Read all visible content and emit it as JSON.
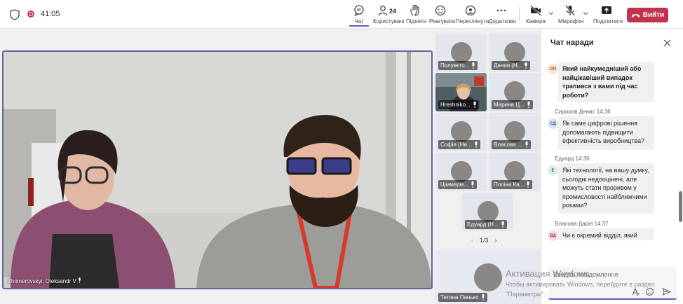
{
  "topbar": {
    "timer": "41:05",
    "participants_count": "24",
    "buttons": {
      "chat": "Чат",
      "people": "Користувачі",
      "raise": "Підняти",
      "react": "Реагувати",
      "view": "Переглянути",
      "more": "Додатково",
      "camera": "Камера",
      "mic": "Мікрофон",
      "share": "Поділитися"
    },
    "leave": "Вийти"
  },
  "main_video": {
    "name": "Zholnerovskyi, Oleksandr V"
  },
  "gallery": {
    "tiles": [
      {
        "name": "Полуекто..."
      },
      {
        "name": "Дания (Н..."
      },
      {
        "name": "Hreshniko..."
      },
      {
        "name": "Марина Ц..."
      },
      {
        "name": "Софія (Не..."
      },
      {
        "name": "Власова ..."
      },
      {
        "name": "Ціммерм..."
      },
      {
        "name": "Поліна Ка..."
      },
      {
        "name": "Едуард (Н..."
      },
      {
        "name": "Тетяна Панько"
      }
    ],
    "page": "1/3"
  },
  "chat": {
    "title": "Чат наради",
    "messages": [
      {
        "sender": "",
        "initials": "OO",
        "text": "Який найкумедніший або найцікавіший випадок трапився з вами під час роботи?",
        "color": "#f8e3d6",
        "fg": "#a0522d"
      },
      {
        "sender": "Сидоров Денис  14:36",
        "initials": "СД",
        "text": "Як саме цифрові рішення допомагають підвищити ефективність виробництва?",
        "color": "#dde3f5",
        "fg": "#3b4b8a"
      },
      {
        "sender": "Едуард  14:36",
        "initials": "Е",
        "text": "Які технології, на вашу думку, сьогодні недооцінені, але можуть стати проривом у промисловості найближчими роками?",
        "color": "#dcefe0",
        "fg": "#2e6b3c"
      },
      {
        "sender": "Власова Дарія  14:37",
        "initials": "ВД",
        "text": "Чи є окремий відділ, який",
        "color": "#f7dedf",
        "fg": "#a0303b"
      }
    ],
    "compose_placeholder": "Введіть повідомлення"
  },
  "watermark": {
    "title": "Активация Windows",
    "line1": "Чтобы активировать Windows, перейдите в раздел",
    "line2": "\"Параметры\"."
  },
  "colors": {
    "accent": "#5b5fc7",
    "leave": "#c4314b",
    "focus_border": "#6264a7"
  }
}
